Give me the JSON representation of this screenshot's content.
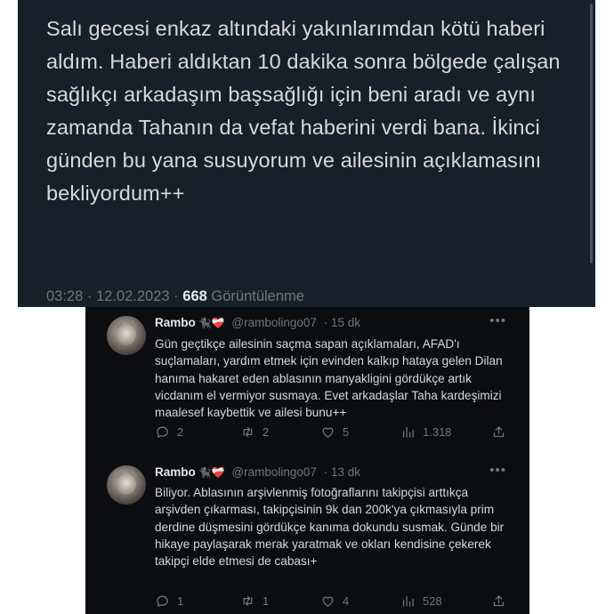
{
  "top_tweet": {
    "text": "Salı gecesi enkaz altındaki yakınlarımdan kötü haberi aldım. Haberi aldıktan 10 dakika sonra bölgede çalışan sağlıkçı arkadaşım başsağlığı için beni aradı ve aynı zamanda Tahanın da vefat haberini verdi bana. İkinci günden bu yana susuyorum ve ailesinin açıklamasını bekliyordum++",
    "time": "03:28",
    "separator": "·",
    "date": "12.02.2023",
    "views_count": "668",
    "views_label": "Görüntülenme"
  },
  "replies": [
    {
      "name": "Rambo",
      "emoji": "🐈‍⬛❤️‍🩹",
      "handle": "@rambolingo07",
      "time": "· 15 dk",
      "text": "Gün geçtikçe ailesinin saçma sapan açıklamaları, AFAD'ı suçlamaları, yardım etmek için evinden kalkıp hataya gelen Dilan hanıma hakaret eden ablasının manyakligini gördükçe artık vicdanım el vermiyor susmaya. Evet arkadaşlar Taha kardeşimizi maalesef kaybettik ve ailesi bunu++",
      "replies_count": "2",
      "retweets_count": "2",
      "likes_count": "5",
      "views_count": "1.318"
    },
    {
      "name": "Rambo",
      "emoji": "🐈‍⬛❤️‍🩹",
      "handle": "@rambolingo07",
      "time": "· 13 dk",
      "text": "Biliyor. Ablasının arşivlenmiş fotoğraflarını takipçisi arttıkça arşivden çıkarması, takipçisinin 9k dan 200k'ya çıkmasıyla prim derdine düşmesini gördükçe kanıma dokundu susmak. Günde bir hikaye paylaşarak merak yaratmak ve okları kendisine çekerek takipçi elde etmesi de cabası+",
      "replies_count": "1",
      "retweets_count": "1",
      "likes_count": "4",
      "views_count": "528"
    }
  ],
  "icons": {
    "more": "more-icon",
    "reply": "reply-icon",
    "retweet": "retweet-icon",
    "like": "heart-icon",
    "views": "views-icon",
    "share": "share-icon"
  },
  "colors": {
    "top_background": "#15202b",
    "bottom_background": "#0b0d10",
    "muted_text": "#6e767d",
    "main_text": "#d9d9d9"
  }
}
